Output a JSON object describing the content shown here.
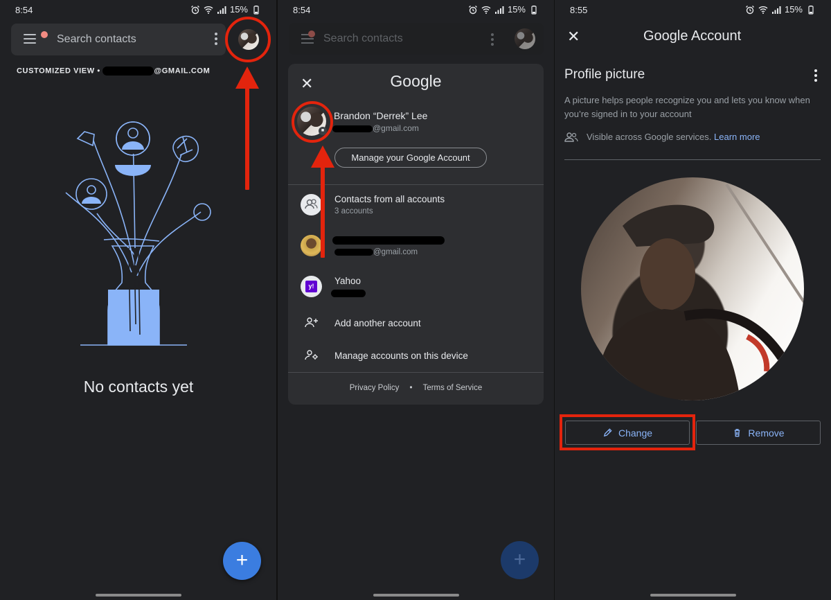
{
  "panel1": {
    "status": {
      "time": "8:54",
      "battery": "15%"
    },
    "search": {
      "placeholder": "Search contacts"
    },
    "view_label_prefix": "CUSTOMIZED VIEW •",
    "view_label_suffix": "@GMAIL.COM",
    "empty_text": "No contacts yet",
    "fab_label": "+"
  },
  "panel2": {
    "status": {
      "time": "8:54",
      "battery": "15%"
    },
    "search": {
      "placeholder": "Search contacts"
    },
    "sheet": {
      "close": "✕",
      "logo": "Google",
      "account_name": "Brandon “Derrek” Lee",
      "account_email_suffix": "@gmail.com",
      "manage_button": "Manage your Google Account",
      "rows": [
        {
          "title": "Contacts from all accounts",
          "subtitle": "3 accounts"
        },
        {
          "title": "",
          "subtitle": "@gmail.com"
        },
        {
          "title": "Yahoo",
          "subtitle": ""
        },
        {
          "title": "Add another account"
        },
        {
          "title": "Manage accounts on this device"
        }
      ],
      "footer_privacy": "Privacy Policy",
      "footer_sep": "•",
      "footer_terms": "Terms of Service"
    },
    "fab_label": "+"
  },
  "panel3": {
    "status": {
      "time": "8:55",
      "battery": "15%"
    },
    "close": "✕",
    "title": "Google Account",
    "heading": "Profile picture",
    "description": "A picture helps people recognize you and lets you know when you’re signed in to your account",
    "visibility": "Visible across Google services.",
    "learn_more": "Learn more",
    "change_button": "Change",
    "remove_button": "Remove"
  },
  "colors": {
    "annotation_red": "#e3240d",
    "accent_blue": "#8ab4f8",
    "fab_blue": "#3b7de0",
    "background": "#202124"
  }
}
